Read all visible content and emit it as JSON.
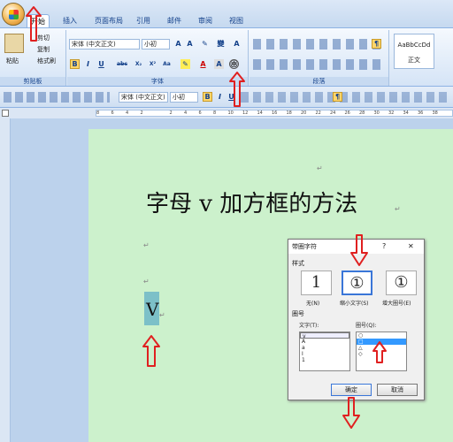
{
  "tabs": [
    "开始",
    "插入",
    "页面布局",
    "引用",
    "邮件",
    "审阅",
    "视图"
  ],
  "clipboard": {
    "cut": "剪切",
    "copy": "复制",
    "paste_label": "粘贴",
    "format_painter": "格式刷",
    "group": "剪贴板"
  },
  "font": {
    "name": "宋体 (中文正文)",
    "size": "小初",
    "group": "字体",
    "glyphs": [
      "B",
      "I",
      "U",
      "abc",
      "X₂",
      "X²",
      "Aa",
      "A",
      "A",
      "㊥"
    ]
  },
  "paragraph": {
    "group": "段落"
  },
  "styles": {
    "preview": "AaBbCcDd",
    "name": "正文"
  },
  "quickbar": {
    "font_name": "宋体 (中文正文)",
    "font_size": "小初"
  },
  "ruler": {
    "ticks": [
      "8",
      "6",
      "4",
      "2",
      "",
      "2",
      "4",
      "6",
      "8",
      "10",
      "12",
      "14",
      "16",
      "18",
      "20",
      "22",
      "24",
      "26",
      "28",
      "30",
      "32",
      "34",
      "36",
      "38"
    ]
  },
  "document": {
    "title": "字母 v 加方框的方法",
    "letter": "V",
    "para_mark": "↵"
  },
  "dialog": {
    "title": "带圈字符",
    "help": "?",
    "close": "✕",
    "style_label": "样式",
    "options": [
      {
        "glyph": "1",
        "label": "无(N)"
      },
      {
        "glyph": "①",
        "label": "缩小文字(S)"
      },
      {
        "glyph": "①",
        "label": "增大圈号(E)"
      }
    ],
    "circle_section": "圈号",
    "text_label": "文字(T):",
    "text_items": [
      "v",
      "A",
      "a",
      "I",
      "1"
    ],
    "circle_label": "圈号(Q):",
    "circle_items": [
      "○",
      "□",
      "△",
      "◇"
    ],
    "ok": "确定",
    "cancel": "取消"
  },
  "colors": {
    "page": "#ccf1cc",
    "arrow": "#e02020",
    "ribbon": "#dce8f7"
  }
}
